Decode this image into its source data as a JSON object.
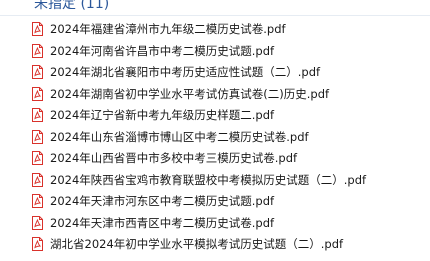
{
  "group": {
    "label": "未指定 (11)"
  },
  "files": [
    {
      "name": "2024年福建省漳州市九年级二模历史试卷.pdf",
      "icon": "pdf-file-icon"
    },
    {
      "name": "2024年河南省许昌市中考二模历史试题.pdf",
      "icon": "pdf-file-icon"
    },
    {
      "name": "2024年湖北省襄阳市中考历史适应性试题（二）.pdf",
      "icon": "pdf-file-icon"
    },
    {
      "name": "2024年湖南省初中学业水平考试仿真试卷(二)历史.pdf",
      "icon": "pdf-file-icon"
    },
    {
      "name": "2024年辽宁省新中考九年级历史样题二.pdf",
      "icon": "pdf-file-icon"
    },
    {
      "name": "2024年山东省淄博市博山区中考二模历史试卷.pdf",
      "icon": "pdf-file-icon"
    },
    {
      "name": "2024年山西省晋中市多校中考三模历史试卷.pdf",
      "icon": "pdf-file-icon"
    },
    {
      "name": "2024年陕西省宝鸡市教育联盟校中考模拟历史试题（二）.pdf",
      "icon": "pdf-file-icon"
    },
    {
      "name": "2024年天津市河东区中考二模历史试题.pdf",
      "icon": "pdf-file-icon"
    },
    {
      "name": "2024年天津市西青区中考二模历史试卷.pdf",
      "icon": "pdf-file-icon"
    },
    {
      "name": "湖北省2024年初中学业水平模拟考试历史试题（二）.pdf",
      "icon": "pdf-file-icon"
    }
  ],
  "colors": {
    "header_text": "#2b579a",
    "pdf_icon": "#d9312b"
  }
}
